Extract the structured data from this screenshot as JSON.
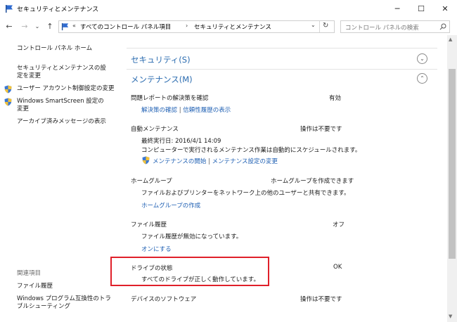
{
  "window": {
    "title": "セキュリティとメンテナンス",
    "minimize": "─",
    "maximize": "☐",
    "close": "✕"
  },
  "address": {
    "prefix": "«",
    "crumb1": "すべてのコントロール パネル項目",
    "crumb2": "セキュリティとメンテナンス",
    "dropdown": "⌄",
    "search_placeholder": "コントロール パネルの検索"
  },
  "sidebar": {
    "home": "コントロール パネル ホーム",
    "item1": "セキュリティとメンテナンスの設定を変更",
    "item2": "ユーザー アカウント制御設定の変更",
    "item3": "Windows SmartScreen 設定の変更",
    "item4": "アーカイブ済みメッセージの表示",
    "related_header": "関連項目",
    "related1": "ファイル履歴",
    "related2": "Windows プログラム互換性のトラブルシューティング"
  },
  "sections": {
    "security": "セキュリティ(S)",
    "maintenance": "メンテナンス(M)"
  },
  "items": {
    "problem_reports": {
      "title": "問題レポートの解決策を確認",
      "status": "有効",
      "link1": "解決策の確認",
      "link2": "信頼性履歴の表示"
    },
    "auto_maintenance": {
      "title": "自動メンテナンス",
      "status": "操作は不要です",
      "last_run": "最終実行日: 2016/4/1 14:09",
      "description": "コンピューターで実行されるメンテナンス作業は自動的にスケジュールされます。",
      "link1": "メンテナンスの開始",
      "link2": "メンテナンス設定の変更"
    },
    "homegroup": {
      "title": "ホームグループ",
      "status": "ホームグループを作成できます",
      "description": "ファイルおよびプリンターをネットワーク上の他のユーザーと共有できます。",
      "link": "ホームグループの作成"
    },
    "file_history": {
      "title": "ファイル履歴",
      "status": "オフ",
      "description": "ファイル履歴が無効になっています。",
      "link": "オンにする"
    },
    "drive_status": {
      "title": "ドライブの状態",
      "status": "OK",
      "description": "すべてのドライブが正しく動作しています。"
    },
    "device_software": {
      "title": "デバイスのソフトウェア",
      "status": "操作は不要です"
    }
  },
  "colors": {
    "link": "#1e5fb3",
    "header": "#2b6cb0",
    "highlight": "#e0202a"
  }
}
